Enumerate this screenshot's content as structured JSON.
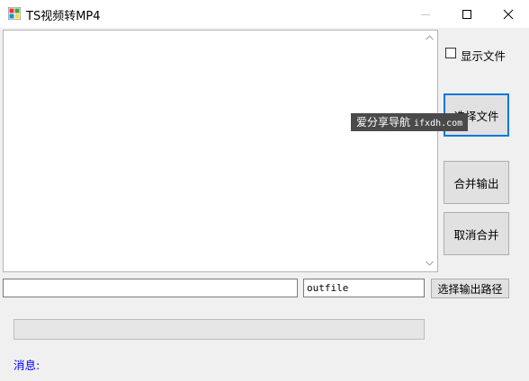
{
  "window": {
    "title": "TS视频转MP4"
  },
  "file_list": {
    "items": []
  },
  "options": {
    "show_files_label": "显示文件",
    "show_files_checked": false
  },
  "buttons": {
    "select_files": "选择文件",
    "merge_output": "合并输出",
    "cancel_merge": "取消合并",
    "select_output_path": "选择输出路径"
  },
  "output": {
    "path_value": "",
    "filename_value": "outfile"
  },
  "progress": {
    "fraction": 0
  },
  "status": {
    "message_label": "消息:"
  },
  "overlay": {
    "site_text": "爱分享导航",
    "site_url": "ifxdh.com"
  },
  "colors": {
    "message_text": "#0000ff",
    "focus_border": "#0078d7"
  }
}
